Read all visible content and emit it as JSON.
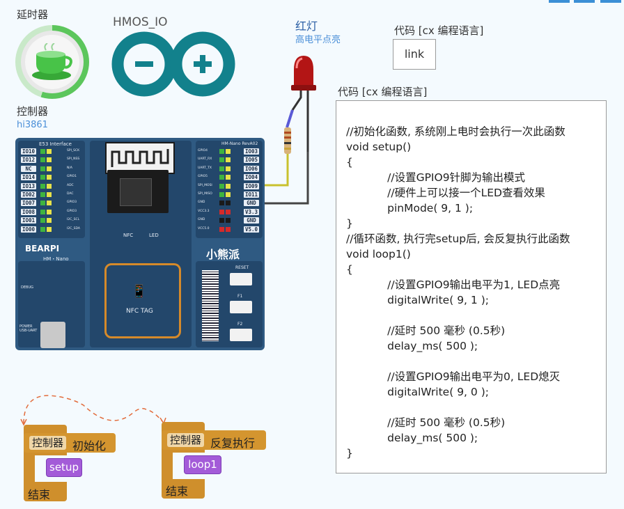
{
  "timer": {
    "label": "延时器"
  },
  "hmos": {
    "label": "HMOS_IO"
  },
  "led": {
    "label": "红灯",
    "sublabel": "高电平点亮"
  },
  "controller": {
    "label": "控制器",
    "model": "hi3861"
  },
  "code_link": {
    "title": "代码 [cx 编程语言]",
    "button_label": "link"
  },
  "code_panel": {
    "title": "代码 [cx 编程语言]",
    "lines": [
      "//初始化函数, 系统刚上电时会执行一次此函数",
      "void setup()",
      "{",
      "            //设置GPIO9针脚为输出模式",
      "            //硬件上可以接一个LED查看效果",
      "            pinMode( 9, 1 );",
      "}",
      "//循环函数, 执行完setup后, 会反复执行此函数",
      "void loop1()",
      "{",
      "            //设置GPIO9输出电平为1, LED点亮",
      "            digitalWrite( 9, 1 );",
      "",
      "            //延时 500 毫秒 (0.5秒)",
      "            delay_ms( 500 );",
      "",
      "            //设置GPIO9输出电平为0, LED熄灭",
      "            digitalWrite( 9, 0 );",
      "",
      "            //延时 500 毫秒 (0.5秒)",
      "            delay_ms( 500 );",
      "}"
    ]
  },
  "board": {
    "interface_label": "E53 Interface",
    "right_header_label": "HM-Nano RevA02",
    "left_pins": [
      "IO10",
      "IO12",
      "NC",
      "IO14",
      "IO13",
      "IO02",
      "IO07",
      "IO08",
      "IO01",
      "IO00"
    ],
    "left_funcs": [
      "SPI_SCK",
      "SPI_NSS",
      "N/A",
      "GPIO1",
      "ADC",
      "DAC",
      "GPIO3",
      "GPIO3",
      "I2C_SCL",
      "I2C_SDA"
    ],
    "right_pins": [
      "IO03",
      "IO05",
      "IO06",
      "IO04",
      "IO09",
      "IO11",
      "GND",
      "V3.3",
      "GND",
      "V5.0"
    ],
    "right_funcs": [
      "GPIO4",
      "UART_RX",
      "UART_TX",
      "GPIO5",
      "SPI_MOSI",
      "SPI_MISO",
      "GND",
      "VCC3.3",
      "GND",
      "VCC5.0"
    ],
    "brand": "BEARPI",
    "brand_sub": "HM・Nano",
    "cn_brand": "小熊派",
    "nfc_label": "NFC",
    "led_label": "LED",
    "nfc_tag": "NFC TAG",
    "reset_label": "RESET",
    "f1_label": "F1",
    "f2_label": "F2",
    "power_label": "POWER USB-UART",
    "debug_label": "DEBUG"
  },
  "blocks": {
    "init": {
      "controller": "控制器",
      "action": "初始化",
      "func": "setup",
      "end": "结束"
    },
    "loop": {
      "controller": "控制器",
      "action": "反复执行",
      "func": "loop1",
      "end": "结束"
    }
  },
  "colors": {
    "accent": "#3b8fd6",
    "block": "#cf8f2c",
    "func_block": "#a35bd8",
    "board": "#2f5a82"
  }
}
